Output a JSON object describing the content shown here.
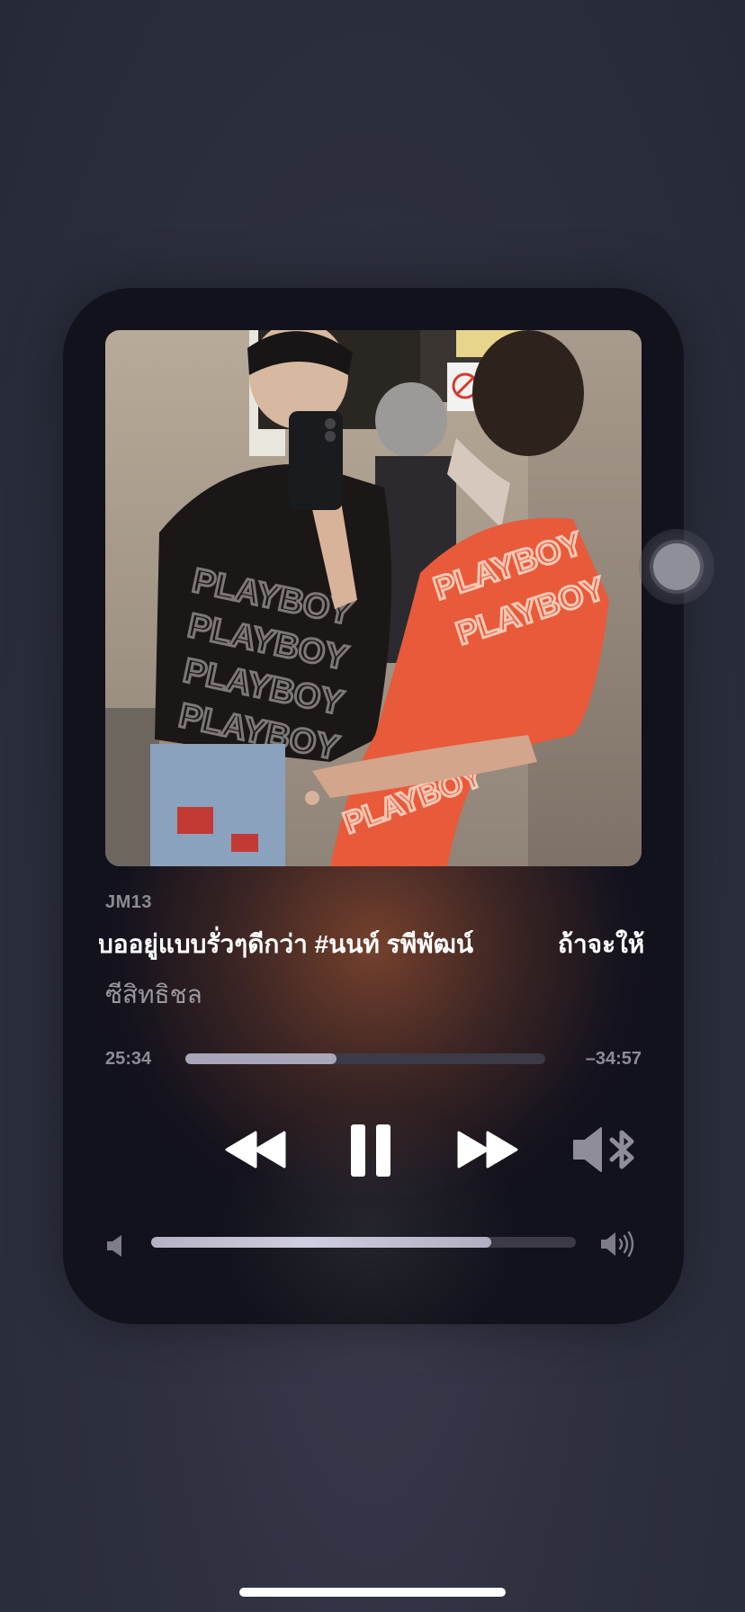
{
  "now_playing": {
    "label": "JM13",
    "title": "บออยู่แบบรั่วๆดีกว่า #นนท์ รพีพัฒน์",
    "title_next": "ถ้าจะให้",
    "artist": "ซีสิทธิชล",
    "artwork": "artwork"
  },
  "playback": {
    "elapsed": "25:34",
    "remaining": "–34:57",
    "progress": 0.42
  },
  "volume": {
    "level": 0.8
  },
  "icons": {
    "rewind": "rewind-icon",
    "pause": "pause-icon",
    "forward": "fast-forward-icon",
    "audio_output": "speaker-bluetooth-icon",
    "volume_low": "volume-low-icon",
    "volume_high": "volume-high-icon"
  },
  "colors": {
    "card_background": "#12121c",
    "accent_glow": "#96503a",
    "scrubber_fill": "#a8a6b8",
    "track_background": "#3b3a46"
  }
}
